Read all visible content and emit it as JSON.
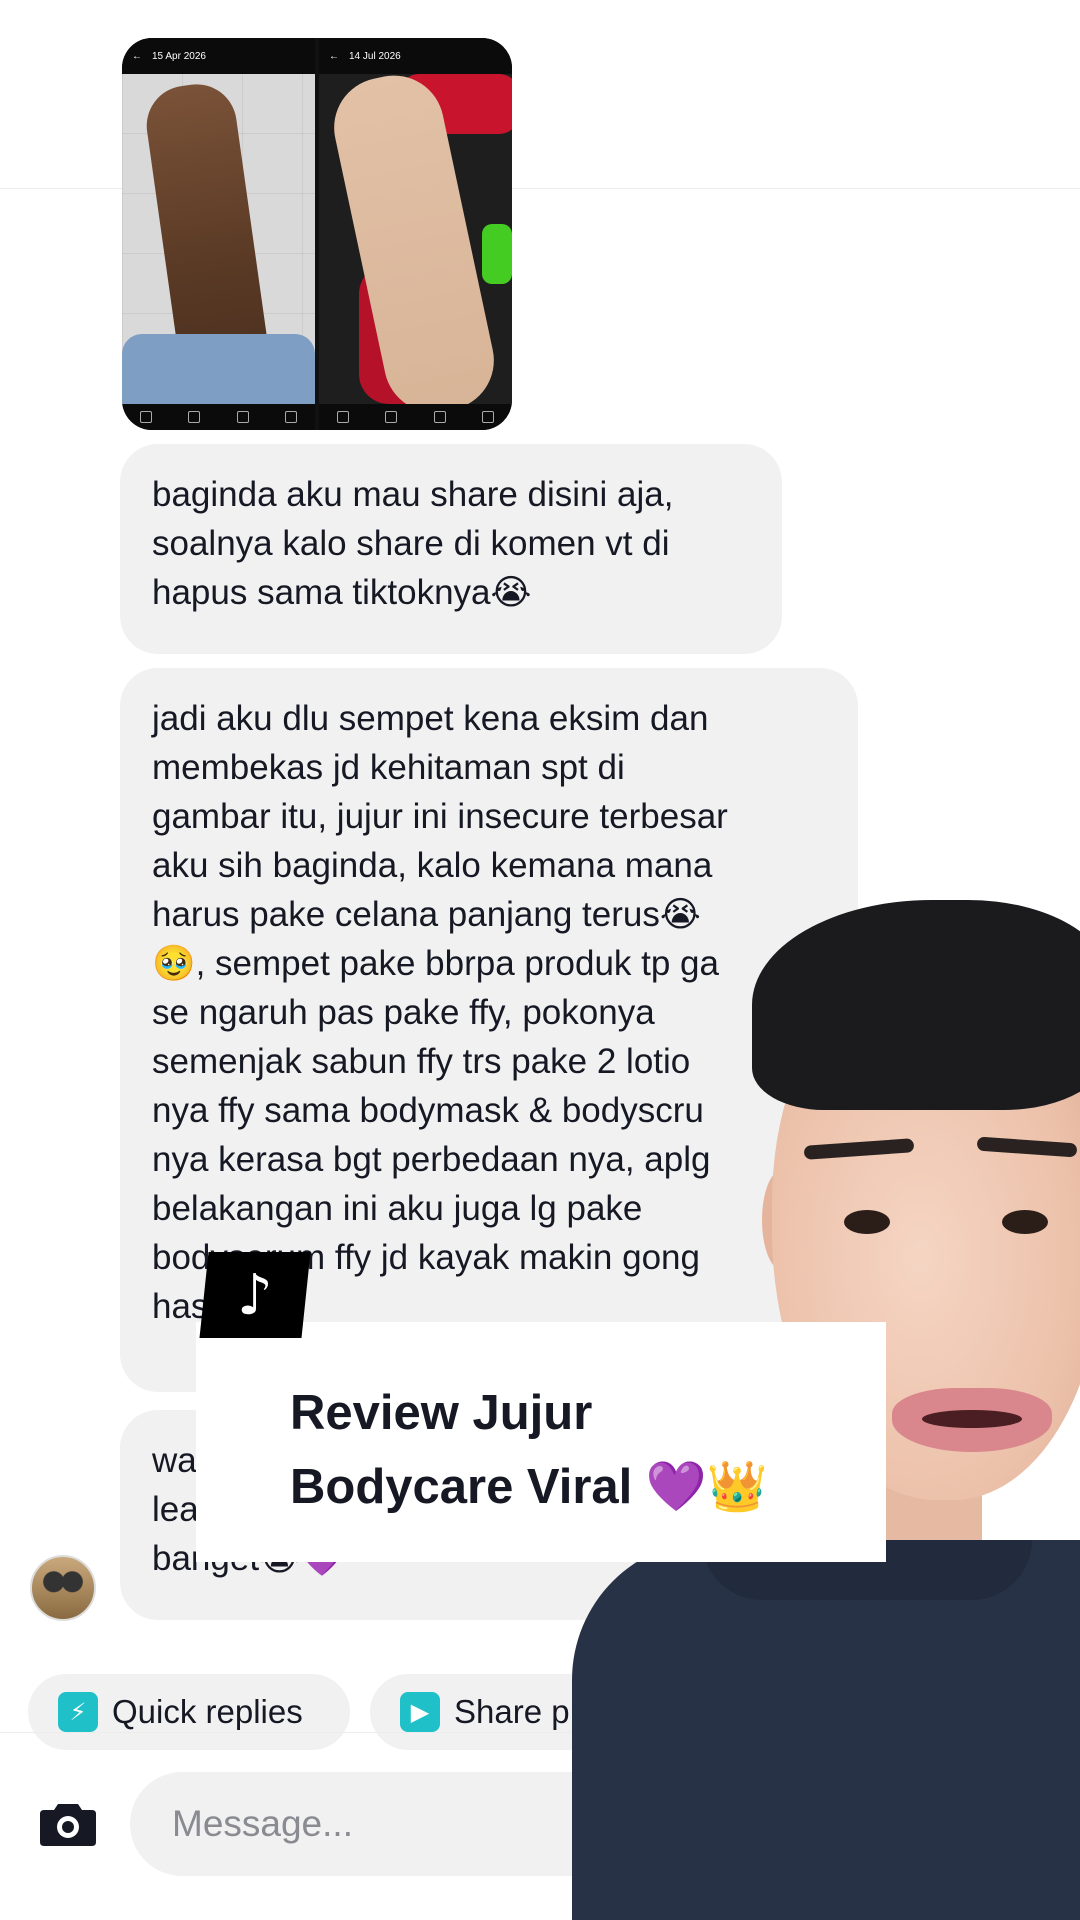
{
  "photos": {
    "left_date": "15 Apr 2026",
    "right_date": "14 Jul 2026"
  },
  "messages": [
    {
      "text": "baginda aku mau share disini aja,\nsoalnya kalo share di komen vt di\nhapus sama tiktoknya😭"
    },
    {
      "text": "jadi aku dlu sempet kena eksim dan\nmembekas jd kehitaman spt di\ngambar itu, jujur ini insecure terbesar\naku sih baginda, kalo kemana mana\nharus pake celana panjang terus😭\n🥹, sempet pake bbrpa produk tp ga\nse ngaruh pas pake ffy, pokonya\nsemenjak sabun ffy trs pake 2 lotio\nnya ffy sama bodymask & bodyscru\nnya kerasa bgt perbedaan nya, aplg\nbelakangan ini aku juga lg pake\nbodyserum ffy jd kayak makin gong\nhas"
    },
    {
      "text": "wa\nlea\nbanget😭💜"
    }
  ],
  "quick_actions": [
    {
      "label": "Quick replies",
      "icon": "lightning-icon"
    },
    {
      "label": "Share p",
      "icon": "play-icon"
    }
  ],
  "composer": {
    "placeholder": "Message..."
  },
  "overlay": {
    "title_line1": "Review Jujur",
    "title_line2": "Bodycare Viral 💜👑",
    "badge_glyph": "♪"
  },
  "colors": {
    "bubble": "#f1f1f2",
    "chip_icon": "#20c0c9",
    "text": "#161823"
  }
}
